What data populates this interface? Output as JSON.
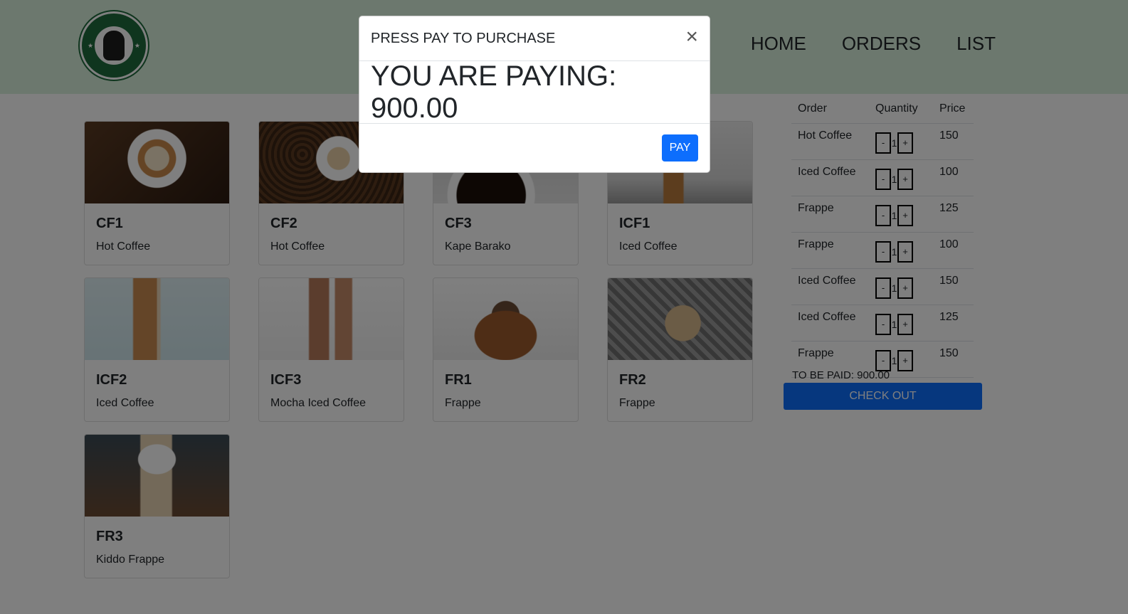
{
  "navbar": {
    "logo_alt": "PONYBUCKS COFFEE",
    "links": [
      "HOME",
      "ORDERS",
      "LIST"
    ]
  },
  "products": [
    {
      "code": "CF1",
      "name": "Hot Coffee",
      "image": "latte-art-cup"
    },
    {
      "code": "CF2",
      "name": "Hot Coffee",
      "image": "coffee-beans-cup"
    },
    {
      "code": "CF3",
      "name": "Kape Barako",
      "image": "black-coffee"
    },
    {
      "code": "ICF1",
      "name": "Iced Coffee",
      "image": "iced-coffee-glass"
    },
    {
      "code": "ICF2",
      "name": "Iced Coffee",
      "image": "iced-coffee-milk"
    },
    {
      "code": "ICF3",
      "name": "Mocha Iced Coffee",
      "image": "mocha-glasses"
    },
    {
      "code": "FR1",
      "name": "Frappe",
      "image": "frappe-on-coaster"
    },
    {
      "code": "FR2",
      "name": "Frappe",
      "image": "frappe-with-straw"
    },
    {
      "code": "FR3",
      "name": "Kiddo Frappe",
      "image": "whipped-frappe"
    }
  ],
  "order_table": {
    "headers": [
      "Order",
      "Quantity",
      "Price"
    ],
    "rows": [
      {
        "order": "Hot Coffee",
        "qty": "1",
        "price": "150"
      },
      {
        "order": "Iced Coffee",
        "qty": "1",
        "price": "100"
      },
      {
        "order": "Frappe",
        "qty": "1",
        "price": "125"
      },
      {
        "order": "Frappe",
        "qty": "1",
        "price": "100"
      },
      {
        "order": "Iced Coffee",
        "qty": "1",
        "price": "150"
      },
      {
        "order": "Iced Coffee",
        "qty": "1",
        "price": "125"
      },
      {
        "order": "Frappe",
        "qty": "1",
        "price": "150"
      }
    ],
    "minus_label": "-",
    "plus_label": "+"
  },
  "summary": {
    "to_be_paid": "TO BE PAID: 900.00",
    "checkout_label": "CHECK OUT"
  },
  "modal": {
    "title": "PRESS PAY TO PURCHASE",
    "close_symbol": "×",
    "paying_text": "YOU ARE PAYING: 900.00",
    "pay_label": "PAY"
  }
}
